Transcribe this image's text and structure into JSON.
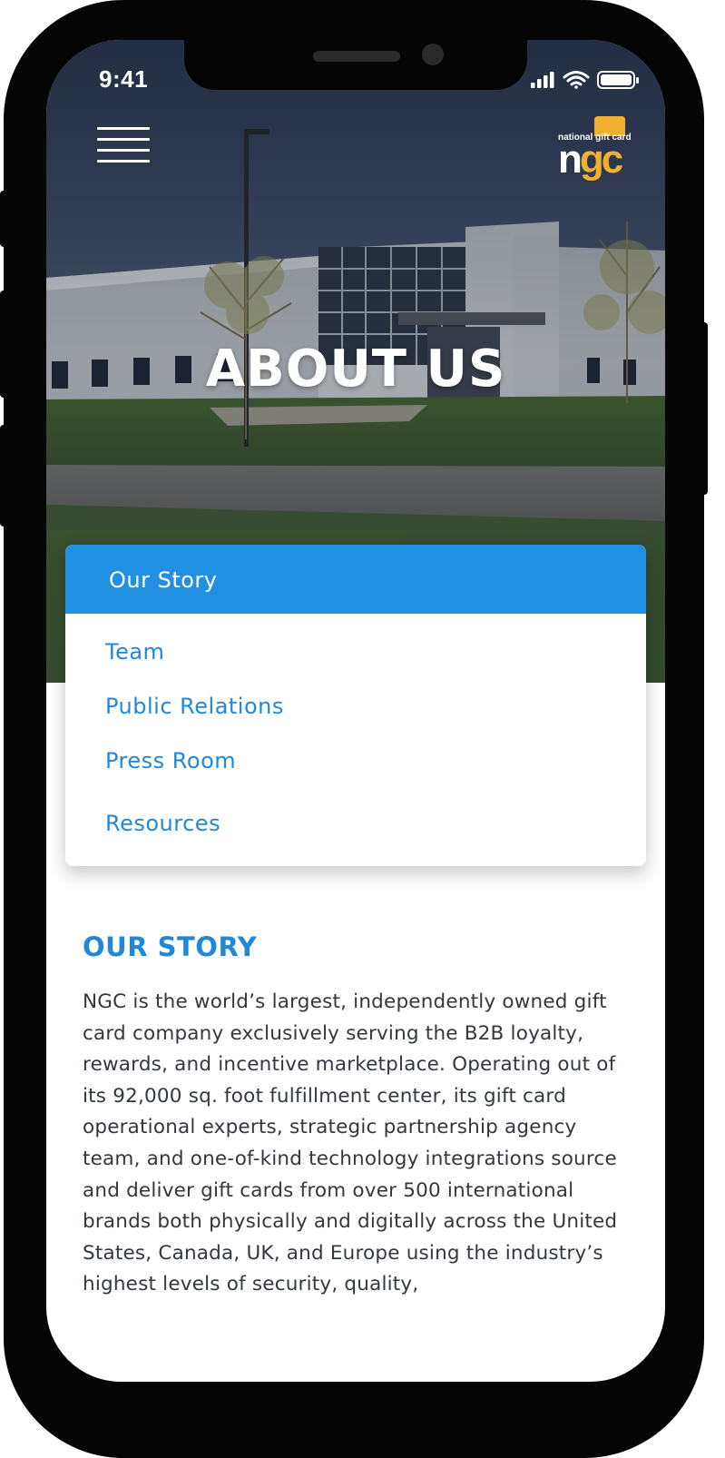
{
  "status_bar": {
    "time": "9:41"
  },
  "header": {
    "menu_icon": "hamburger-menu-icon",
    "logo": {
      "tagline": "national gift card",
      "wordmark_start": "n",
      "wordmark_end": "gc",
      "accent_color": "#f0b030"
    }
  },
  "hero": {
    "title": "ABOUT US"
  },
  "section_nav": {
    "selected": "Our Story",
    "items": [
      {
        "label": "Team"
      },
      {
        "label": "Public Relations"
      },
      {
        "label": "Press Room"
      },
      {
        "label": "Resources"
      }
    ],
    "selected_color": "#2190e3",
    "link_color": "#2188d9"
  },
  "content": {
    "heading": "OUR STORY",
    "body": "NGC is the world’s largest, independently owned gift card company exclusively serving the B2B loyalty, rewards, and incentive marketplace. Operating out of its 92,000 sq. foot fulfillment center, its gift card operational experts, strategic partnership agency team, and one-of-kind technology integrations source and deliver gift cards from over 500 international brands both physically and digitally across the United States, Canada, UK, and Europe using the industry’s highest levels of security, quality,"
  }
}
